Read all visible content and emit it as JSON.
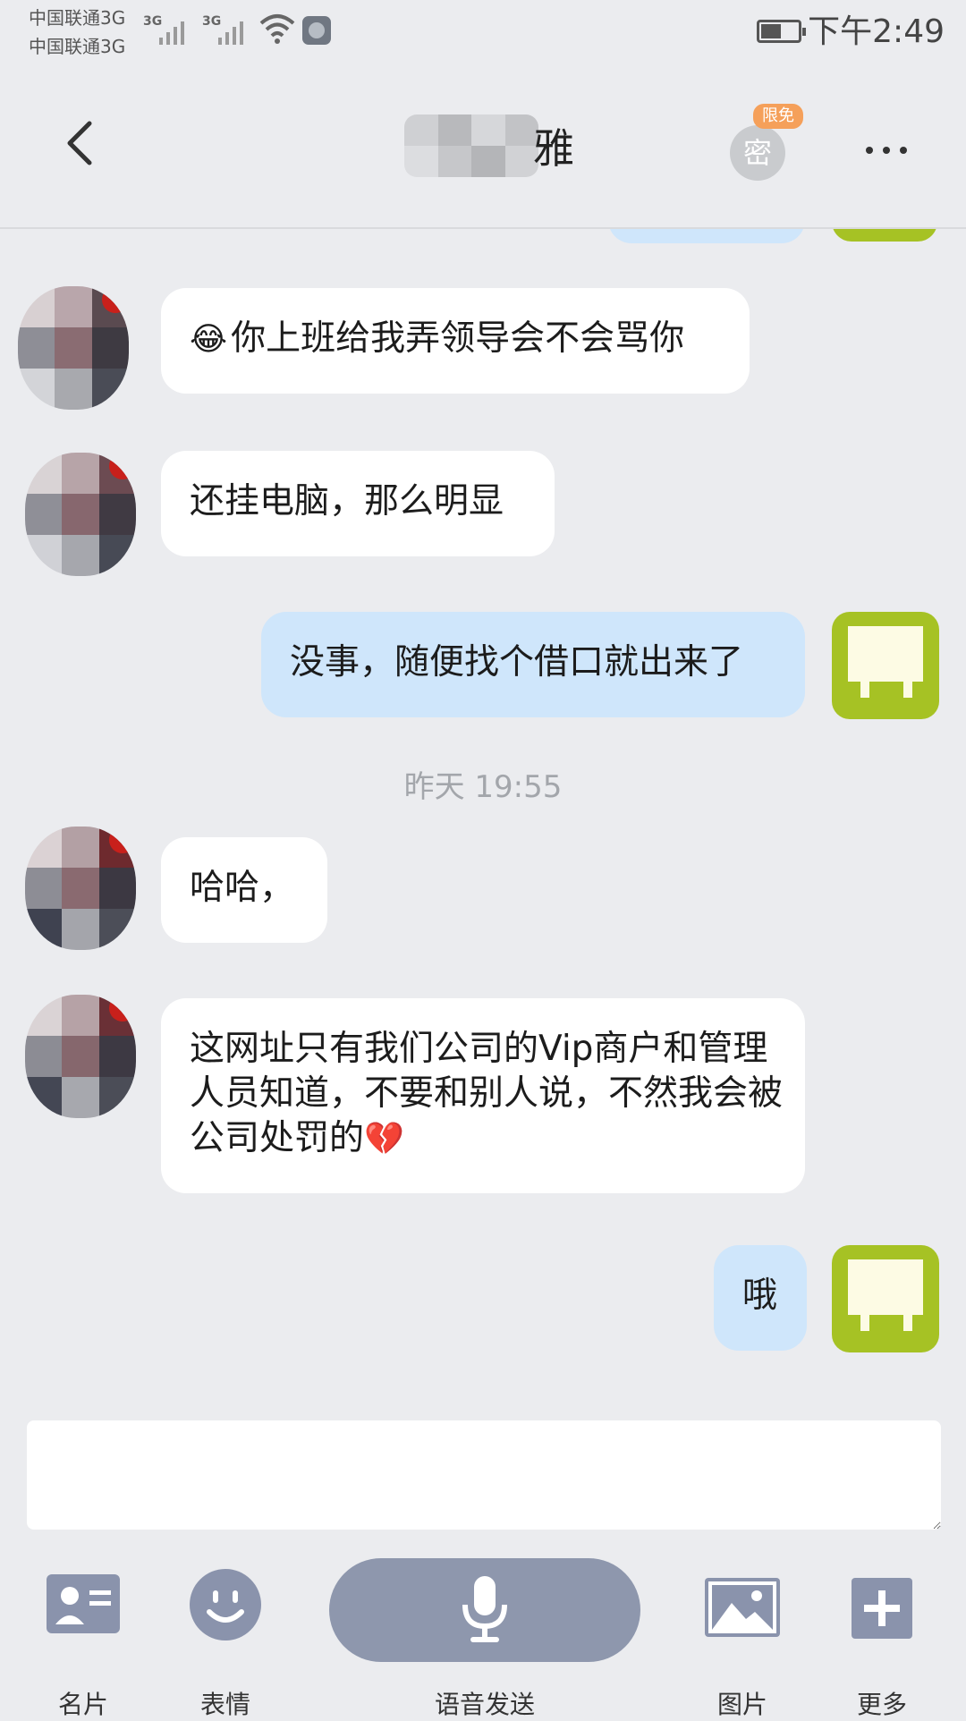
{
  "status_bar": {
    "carrier_1": "中国联通3G",
    "carrier_2": "中国联通3G",
    "signal_1": "3G",
    "signal_2": "3G",
    "time": "下午2:49"
  },
  "header": {
    "title": "雅",
    "badge": "限免",
    "secret_label": "密"
  },
  "messages": {
    "m1": {
      "emoji": "😂",
      "text": "你上班给我弄领导会不会骂你"
    },
    "m2": {
      "text": "还挂电脑，那么明显"
    },
    "m3": {
      "text": "没事，随便找个借口就出来了"
    },
    "timestamp": "昨天 19:55",
    "m4": {
      "text": "哈哈，"
    },
    "m5": {
      "text": "这网址只有我们公司的Vip商户和管理人员知道，不要和别人说，不然我会被公司处罚的",
      "emoji": "💔"
    },
    "m6": {
      "text": "哦"
    }
  },
  "input": {
    "placeholder": ""
  },
  "toolbar": {
    "card_label": "名片",
    "emoji_label": "表情",
    "voice_label": "语音发送",
    "image_label": "图片",
    "more_label": "更多"
  },
  "colors": {
    "background": "#ebecef",
    "bubble_in": "#ffffff",
    "bubble_out": "#cfe6fb",
    "self_avatar": "#a6c224",
    "toolbar_icon": "#8a93ac",
    "badge": "#f5a05a"
  }
}
